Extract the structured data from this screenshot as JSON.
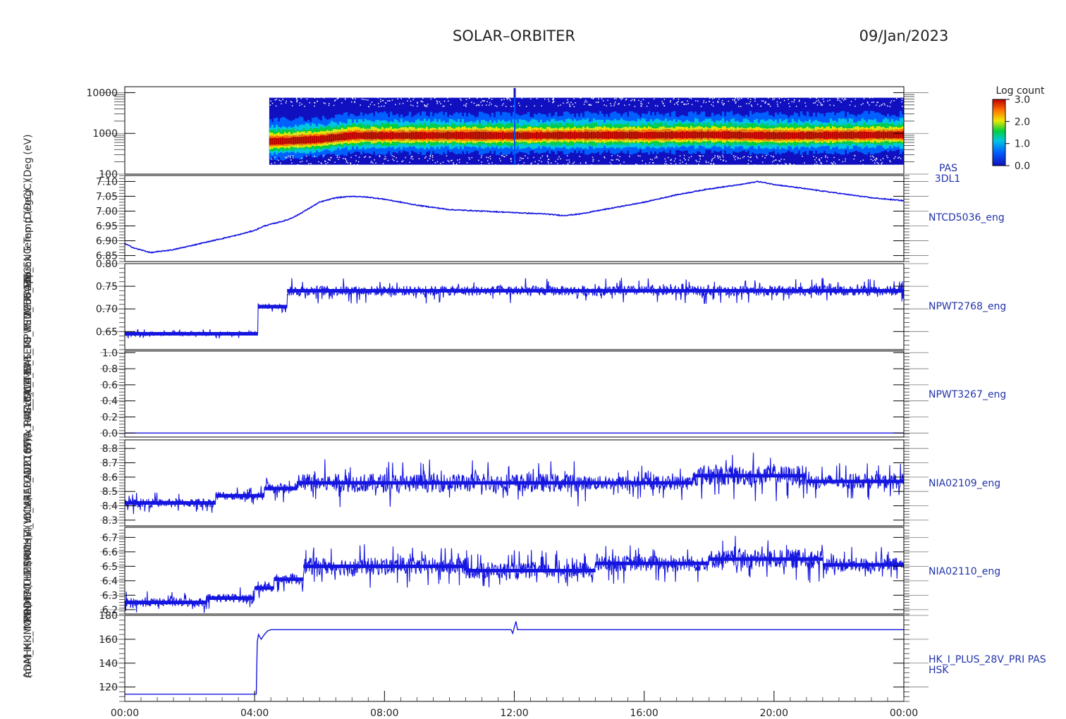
{
  "header": {
    "mission": "SOLAR–ORBITER",
    "date": "09/Jan/2023"
  },
  "y_axis_labels": [
    "(eV)",
    "(Deg",
    "Temp (DegC)",
    "Approx Temp (DegC)",
    "TCD5036_ENG",
    "PWT2768_ENG",
    "IWR_TO_PSU_FRAME",
    "SWA_EAS_TS_TEMP",
    "ELT_CLMF_TEMP",
    "PWA_0L_T17",
    "SWA_PAS_CALT",
    "IA02109 (x1e4_nt)",
    "IA02110 (nT)",
    "4_HI_VREF_INT (nT)",
    "CCA4",
    "MSRMHE (Volts)",
    "THERMO (V)",
    "FOOTMULT (Volts)",
    "PRIME",
    "HK_IMON (mA)",
    "ADM_HK_IMON",
    "(mA)"
  ],
  "x_axis": {
    "ticks": [
      "00:00",
      "04:00",
      "08:00",
      "12:00",
      "16:00",
      "20:00",
      "00:00"
    ]
  },
  "colorbar": {
    "title": "Log count",
    "ticks": [
      "3.0",
      "2.0",
      "1.0",
      "0.0"
    ],
    "min": 0.0,
    "max": 3.0
  },
  "chart_data": [
    {
      "type": "heatmap",
      "label": [
        "PAS",
        "3DL1"
      ],
      "y_scale": "log",
      "ylim": [
        100,
        14000
      ],
      "yticks": [
        "10000",
        "1000",
        "100"
      ],
      "x_units": "hours",
      "data_start_hour": 4.45,
      "energy_band": {
        "low_eV": 170,
        "high_eV": 7500
      },
      "peak_energy_eV": [
        [
          4.45,
          620
        ],
        [
          5.0,
          640
        ],
        [
          6.0,
          700
        ],
        [
          7.0,
          860
        ],
        [
          8.0,
          860
        ],
        [
          10.0,
          870
        ],
        [
          12.0,
          860
        ],
        [
          14.0,
          880
        ],
        [
          16.0,
          880
        ],
        [
          18.0,
          900
        ],
        [
          20.0,
          860
        ],
        [
          22.0,
          880
        ],
        [
          24.0,
          900
        ]
      ],
      "spike": {
        "time": 12.0,
        "energy_eV": 13000
      }
    },
    {
      "type": "line",
      "label": "NTCD5036_eng",
      "ylim": [
        6.83,
        7.12
      ],
      "yticks": [
        "7.10",
        "7.05",
        "7.00",
        "6.95",
        "6.90",
        "6.85"
      ],
      "x": [
        0.0,
        0.3,
        0.8,
        1.5,
        2.5,
        3.5,
        4.0,
        4.3,
        5.0,
        5.3,
        6.0,
        6.5,
        7.0,
        7.5,
        8.0,
        9.0,
        10.0,
        11.0,
        12.0,
        13.0,
        13.5,
        14.0,
        15.0,
        16.0,
        17.0,
        18.0,
        19.0,
        19.5,
        20.0,
        21.0,
        22.0,
        23.0,
        24.0
      ],
      "y": [
        6.89,
        6.875,
        6.86,
        6.87,
        6.895,
        6.92,
        6.935,
        6.95,
        6.97,
        6.985,
        7.03,
        7.045,
        7.05,
        7.047,
        7.04,
        7.02,
        7.005,
        7.0,
        6.995,
        6.99,
        6.985,
        6.99,
        7.01,
        7.03,
        7.055,
        7.075,
        7.09,
        7.1,
        7.09,
        7.075,
        7.06,
        7.045,
        7.035
      ],
      "noise": 0.003
    },
    {
      "type": "line",
      "label": "NPWT2768_eng",
      "ylim": [
        0.61,
        0.8
      ],
      "yticks": [
        "0.80",
        "0.75",
        "0.70",
        "0.65"
      ],
      "segments": [
        {
          "from": 0.0,
          "to": 4.1,
          "level": 0.645,
          "spread": 0.008
        },
        {
          "from": 4.1,
          "to": 5.0,
          "level": 0.705,
          "spread": 0.01
        },
        {
          "from": 5.0,
          "to": 24.0,
          "level": 0.74,
          "spread": 0.022
        }
      ]
    },
    {
      "type": "line",
      "label": "NPWT3267_eng",
      "ylim": [
        -0.05,
        1.02
      ],
      "yticks": [
        "1.0",
        "0.8",
        "0.6",
        "0.4",
        "0.2",
        "0.0"
      ],
      "x": [
        0.0,
        24.0
      ],
      "y": [
        0.0,
        0.0
      ]
    },
    {
      "type": "line",
      "label": "NIA02109_eng",
      "ylim": [
        8.26,
        8.86
      ],
      "yticks": [
        "8.8",
        "8.7",
        "8.6",
        "8.5",
        "8.4",
        "8.3"
      ],
      "segments": [
        {
          "from": 0.0,
          "to": 2.8,
          "level": 8.42,
          "spread": 0.06
        },
        {
          "from": 2.8,
          "to": 4.3,
          "level": 8.47,
          "spread": 0.06
        },
        {
          "from": 4.3,
          "to": 5.3,
          "level": 8.52,
          "spread": 0.08
        },
        {
          "from": 5.3,
          "to": 14.0,
          "level": 8.56,
          "spread": 0.13
        },
        {
          "from": 14.0,
          "to": 17.5,
          "level": 8.56,
          "spread": 0.1
        },
        {
          "from": 17.5,
          "to": 21.0,
          "level": 8.61,
          "spread": 0.14
        },
        {
          "from": 21.0,
          "to": 24.0,
          "level": 8.57,
          "spread": 0.1
        }
      ]
    },
    {
      "type": "line",
      "label": "NIA02110_eng",
      "ylim": [
        6.17,
        6.77
      ],
      "yticks": [
        "6.7",
        "6.6",
        "6.5",
        "6.4",
        "6.3",
        "6.2"
      ],
      "segments": [
        {
          "from": 0.0,
          "to": 2.5,
          "level": 6.25,
          "spread": 0.06
        },
        {
          "from": 2.5,
          "to": 4.0,
          "level": 6.28,
          "spread": 0.06
        },
        {
          "from": 4.0,
          "to": 4.6,
          "level": 6.35,
          "spread": 0.06
        },
        {
          "from": 4.6,
          "to": 5.5,
          "level": 6.41,
          "spread": 0.07
        },
        {
          "from": 5.5,
          "to": 10.5,
          "level": 6.5,
          "spread": 0.12
        },
        {
          "from": 10.5,
          "to": 14.5,
          "level": 6.47,
          "spread": 0.11
        },
        {
          "from": 14.5,
          "to": 18.0,
          "level": 6.52,
          "spread": 0.11
        },
        {
          "from": 18.0,
          "to": 21.5,
          "level": 6.55,
          "spread": 0.13
        },
        {
          "from": 21.5,
          "to": 24.0,
          "level": 6.51,
          "spread": 0.1
        }
      ]
    },
    {
      "type": "line",
      "label": [
        "HK_I_PLUS_28V_PRI PAS",
        "HSK"
      ],
      "ylim": [
        108,
        180
      ],
      "yticks": [
        "180",
        "160",
        "140",
        "120"
      ],
      "x": [
        0.0,
        4.05,
        4.08,
        4.12,
        4.2,
        4.3,
        4.4,
        4.5,
        4.6,
        11.9,
        11.95,
        12.05,
        12.1,
        12.2,
        24.0
      ],
      "y": [
        114,
        114,
        158,
        164,
        160,
        164,
        167,
        168,
        168,
        168,
        165,
        175,
        168,
        168,
        168
      ]
    }
  ]
}
